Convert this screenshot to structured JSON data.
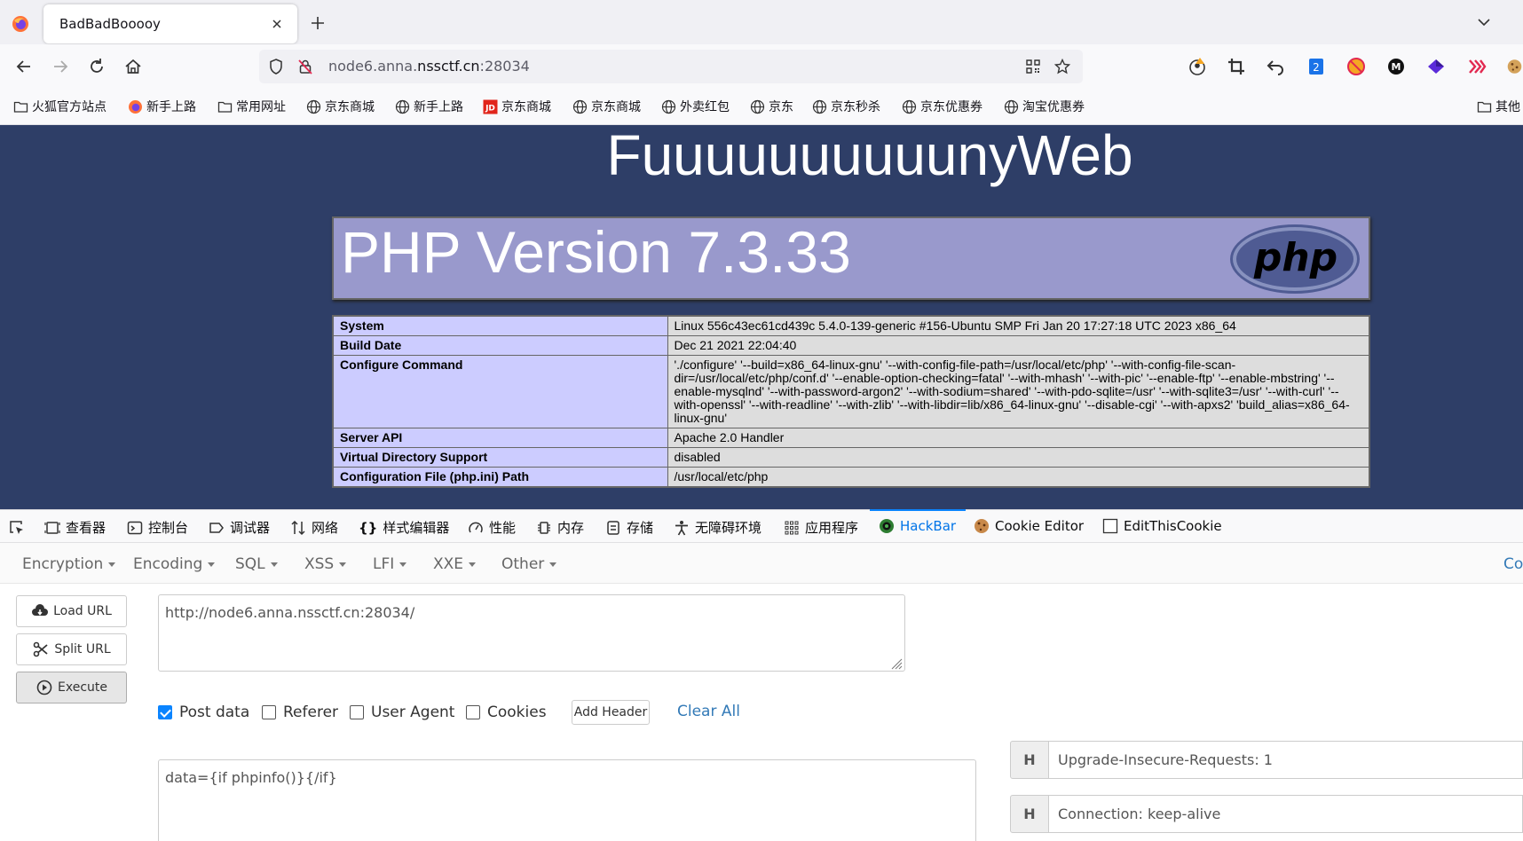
{
  "tab": {
    "title": "BadBadBooooy"
  },
  "address": {
    "prefix": "node6.anna.",
    "domain": "nssctf.cn",
    "port": ":28034"
  },
  "bookmarks": [
    {
      "label": "火狐官方站点",
      "icon": "folder-icon"
    },
    {
      "label": "新手上路",
      "icon": "firefox-icon"
    },
    {
      "label": "常用网址",
      "icon": "folder-icon"
    },
    {
      "label": "京东商城",
      "icon": "globe-icon"
    },
    {
      "label": "新手上路",
      "icon": "globe-icon"
    },
    {
      "label": "京东商城",
      "icon": "jd-icon"
    },
    {
      "label": "京东商城",
      "icon": "globe-icon"
    },
    {
      "label": "外卖红包",
      "icon": "globe-icon"
    },
    {
      "label": "京东",
      "icon": "globe-icon"
    },
    {
      "label": "京东秒杀",
      "icon": "globe-icon"
    },
    {
      "label": "京东优惠券",
      "icon": "globe-icon"
    },
    {
      "label": "淘宝优惠券",
      "icon": "globe-icon"
    },
    {
      "label": "其他",
      "icon": "folder-icon"
    }
  ],
  "page": {
    "title": "FuuuuuuuuuunyWeb",
    "php_version": "PHP Version 7.3.33",
    "php_logo_text": "php",
    "rows": [
      {
        "key": "System",
        "value": "Linux 556c43ec61cd439c 5.4.0-139-generic #156-Ubuntu SMP Fri Jan 20 17:27:18 UTC 2023 x86_64"
      },
      {
        "key": "Build Date",
        "value": "Dec 21 2021 22:04:40"
      },
      {
        "key": "Configure Command",
        "value": "'./configure' '--build=x86_64-linux-gnu' '--with-config-file-path=/usr/local/etc/php' '--with-config-file-scan-dir=/usr/local/etc/php/conf.d' '--enable-option-checking=fatal' '--with-mhash' '--with-pic' '--enable-ftp' '--enable-mbstring' '--enable-mysqlnd' '--with-password-argon2' '--with-sodium=shared' '--with-pdo-sqlite=/usr' '--with-sqlite3=/usr' '--with-curl' '--with-openssl' '--with-readline' '--with-zlib' '--with-libdir=lib/x86_64-linux-gnu' '--disable-cgi' '--with-apxs2' 'build_alias=x86_64-linux-gnu'"
      },
      {
        "key": "Server API",
        "value": "Apache 2.0 Handler"
      },
      {
        "key": "Virtual Directory Support",
        "value": "disabled"
      },
      {
        "key": "Configuration File (php.ini) Path",
        "value": "/usr/local/etc/php"
      }
    ]
  },
  "devtools": {
    "tabs": [
      "查看器",
      "控制台",
      "调试器",
      "网络",
      "样式编辑器",
      "性能",
      "内存",
      "存储",
      "无障碍环境",
      "应用程序",
      "HackBar",
      "Cookie Editor",
      "EditThisCookie"
    ],
    "active": "HackBar"
  },
  "hackbar": {
    "menu": [
      "Encryption",
      "Encoding",
      "SQL",
      "XSS",
      "LFI",
      "XXE",
      "Other"
    ],
    "contact": "Co",
    "buttons": {
      "load": "Load URL",
      "split": "Split URL",
      "execute": "Execute"
    },
    "url": "http://node6.anna.nssctf.cn:28034/",
    "options": [
      {
        "label": "Post data",
        "checked": true
      },
      {
        "label": "Referer",
        "checked": false
      },
      {
        "label": "User Agent",
        "checked": false
      },
      {
        "label": "Cookies",
        "checked": false
      }
    ],
    "add_header": "Add Header",
    "clear_all": "Clear All",
    "post_data": "data={if phpinfo()}{/if}",
    "headers": [
      {
        "tag": "H",
        "value": "Upgrade-Insecure-Requests: 1"
      },
      {
        "tag": "H",
        "value": "Connection: keep-alive"
      }
    ]
  },
  "colors": {
    "page_bg": "#2e3e67",
    "php_header": "#9999cc",
    "key_cell": "#ccccff",
    "value_cell": "#dddddd",
    "accent": "#0a84ff"
  }
}
